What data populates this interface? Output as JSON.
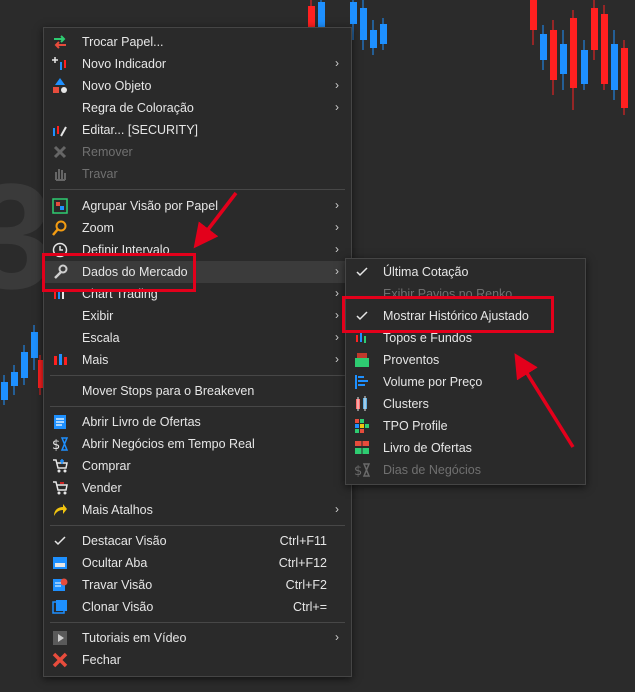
{
  "main_menu": {
    "items": [
      {
        "label": "Trocar Papel...",
        "icon": "swap-arrows-icon"
      },
      {
        "label": "Novo Indicador",
        "icon": "indicator-plus-icon",
        "submenu": true
      },
      {
        "label": "Novo Objeto",
        "icon": "shapes-icon",
        "submenu": true
      },
      {
        "label": "Regra de Coloração",
        "submenu": true
      },
      {
        "label": "Editar... [SECURITY]",
        "icon": "edit-chart-icon"
      },
      {
        "label": "Remover",
        "icon": "remove-x-icon",
        "disabled": true
      },
      {
        "label": "Travar",
        "icon": "hand-icon",
        "disabled": true
      },
      {
        "label": "Agrupar Visão por Papel",
        "icon": "group-icon",
        "submenu": true
      },
      {
        "label": "Zoom",
        "icon": "magnifier-icon",
        "submenu": true
      },
      {
        "label": "Definir Intervalo",
        "icon": "clock-icon",
        "submenu": true
      },
      {
        "label": "Dados do Mercado",
        "icon": "wrench-icon",
        "submenu": true
      },
      {
        "label": "Chart Trading",
        "icon": "chart-trading-icon",
        "submenu": true
      },
      {
        "label": "Exibir",
        "submenu": true
      },
      {
        "label": "Escala",
        "submenu": true
      },
      {
        "label": "Mais",
        "icon": "candles-icon",
        "submenu": true
      },
      {
        "label": "Mover Stops para o Breakeven"
      },
      {
        "label": "Abrir Livro de Ofertas",
        "icon": "book-icon"
      },
      {
        "label": "Abrir Negócios em Tempo Real",
        "icon": "dollar-hourglass-icon"
      },
      {
        "label": "Comprar",
        "icon": "cart-buy-icon"
      },
      {
        "label": "Vender",
        "icon": "cart-sell-icon"
      },
      {
        "label": "Mais Atalhos",
        "icon": "shortcut-arrow-icon",
        "submenu": true
      },
      {
        "label": "Destacar Visão",
        "check": true,
        "shortcut": "Ctrl+F11"
      },
      {
        "label": "Ocultar Aba",
        "icon": "hide-tab-icon",
        "shortcut": "Ctrl+F12"
      },
      {
        "label": "Travar Visão",
        "icon": "lock-view-icon",
        "shortcut": "Ctrl+F2"
      },
      {
        "label": "Clonar Visão",
        "icon": "clone-view-icon",
        "shortcut": "Ctrl+="
      },
      {
        "label": "Tutoriais em Vídeo",
        "icon": "video-icon",
        "submenu": true
      },
      {
        "label": "Fechar",
        "icon": "close-red-icon"
      }
    ]
  },
  "sub_menu": {
    "items": [
      {
        "label": "Última Cotação",
        "check": true
      },
      {
        "label": "Exibir Pavios no Renko",
        "disabled": true
      },
      {
        "label": "Mostrar Histórico Ajustado",
        "check": true
      },
      {
        "label": "Topos e Fundos",
        "icon": "tops-bottoms-icon"
      },
      {
        "label": "Proventos",
        "icon": "dividends-icon"
      },
      {
        "label": "Volume por Preço",
        "icon": "volume-profile-icon"
      },
      {
        "label": "Clusters",
        "icon": "clusters-icon"
      },
      {
        "label": "TPO Profile",
        "icon": "tpo-icon"
      },
      {
        "label": "Livro de Ofertas",
        "icon": "order-book-icon"
      },
      {
        "label": "Dias de Negócios",
        "icon": "dollar-hourglass-icon",
        "disabled": true
      }
    ]
  },
  "background": {
    "price_fragment": "3"
  },
  "colors": {
    "highlight": "#e3001b",
    "bull": "#1e90ff",
    "bear": "#ff1a1a",
    "menu_bg": "#2a2a2a"
  }
}
